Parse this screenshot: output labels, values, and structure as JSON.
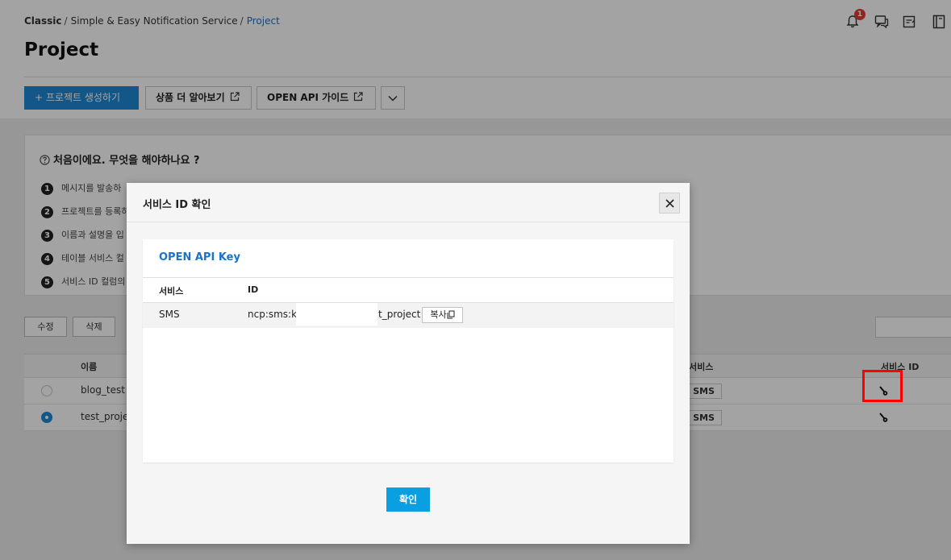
{
  "breadcrumb": {
    "root": "Classic",
    "service": "Simple & Easy Notification Service",
    "current": "Project",
    "separator": "/"
  },
  "page_title": "Project",
  "header_icons": {
    "notification_count": "1",
    "icons": [
      "bell-icon",
      "chat-icon",
      "memo-icon",
      "book-icon"
    ]
  },
  "toolbar": {
    "create_label": "+ 프로젝트 생성하기",
    "learn_more_label": "상품 더 알아보기",
    "api_guide_label": "OPEN API 가이드"
  },
  "guide": {
    "title": "처음이에요. 무엇을 해야하나요 ?",
    "steps": [
      {
        "num": "1",
        "text": "메시지를 발송하"
      },
      {
        "num": "2",
        "text": "프로젝트를 등록하"
      },
      {
        "num": "3",
        "text": "이름과 설명을 입"
      },
      {
        "num": "4",
        "text": "테이블 서비스 컬"
      },
      {
        "num": "5",
        "text": "서비스 ID 컬럼의"
      }
    ]
  },
  "actions": {
    "edit_label": "수정",
    "delete_label": "삭제"
  },
  "table": {
    "columns": {
      "name": "이름",
      "service": "서비스",
      "service_id": "서비스 ID"
    },
    "rows": [
      {
        "name": "blog_test",
        "service": "SMS",
        "selected": false
      },
      {
        "name": "test_projec",
        "service": "SMS",
        "selected": true
      }
    ]
  },
  "modal": {
    "title": "서비스 ID 확인",
    "card_title": "OPEN API Key",
    "columns": {
      "service": "서비스",
      "id": "ID"
    },
    "row": {
      "service": "SMS",
      "id_prefix": "ncp:sms:kr",
      "id_suffix": "t_project",
      "copy_label": "복사"
    },
    "ok_label": "확인"
  },
  "colors": {
    "primary": "#1e88d6",
    "link": "#1a73c9",
    "confirm": "#0a9fe0",
    "badge": "#e53935",
    "highlight": "#ff0000"
  }
}
